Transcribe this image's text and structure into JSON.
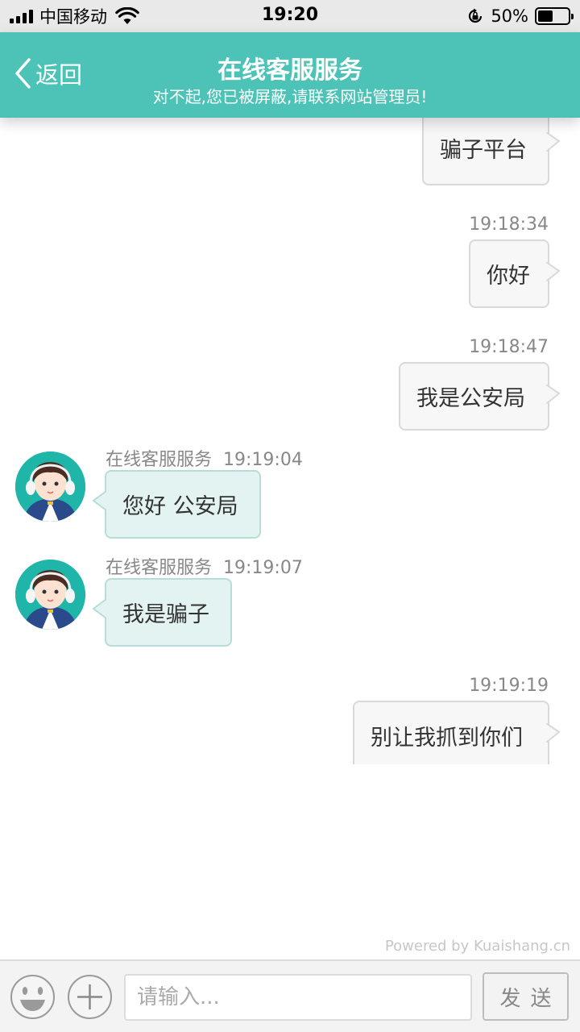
{
  "status_bar": {
    "carrier": "中国移动",
    "time": "19:20",
    "battery": "50%",
    "battery_level": 0.5,
    "icons": [
      "signal-icon",
      "wifi-icon",
      "orientation-lock-icon",
      "battery-icon"
    ]
  },
  "header": {
    "back_label": "返回",
    "title": "在线客服服务",
    "subtitle": "对不起,您已被屏蔽,请联系网站管理员!"
  },
  "messages": [
    {
      "direction": "out",
      "time": "",
      "text": "骗子平台"
    },
    {
      "direction": "out",
      "time": "19:18:34",
      "text": "你好"
    },
    {
      "direction": "out",
      "time": "19:18:47",
      "text": "我是公安局"
    },
    {
      "direction": "in",
      "agent": "在线客服服务",
      "time": "19:19:04",
      "text": "您好 公安局"
    },
    {
      "direction": "in",
      "agent": "在线客服服务",
      "time": "19:19:07",
      "text": "我是骗子"
    },
    {
      "direction": "out",
      "time": "19:19:19",
      "text": "别让我抓到你们"
    }
  ],
  "footer": {
    "powered_by": "Powered by Kuaishang.cn",
    "input_placeholder": "请输入...",
    "send_label": "发送",
    "emoji_icon": "emoji-icon",
    "plus_icon": "plus-icon"
  },
  "colors": {
    "header_bg": "#4cc3b6",
    "incoming_bubble": "#e3f3f1",
    "outgoing_bubble": "#f7f7f7"
  }
}
